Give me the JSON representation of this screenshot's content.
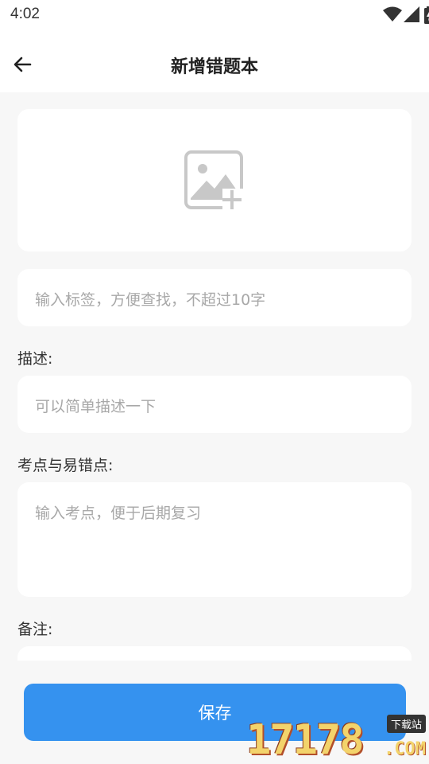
{
  "status_bar": {
    "time": "4:02",
    "icons": [
      "wifi-icon",
      "signal-icon",
      "battery-icon"
    ]
  },
  "app_bar": {
    "back_icon": "arrow-left-icon",
    "title": "新增错题本"
  },
  "form": {
    "image_upload_icon": "add-image-icon",
    "tag_placeholder": "输入标签，方便查找，不超过10字",
    "description_label": "描述:",
    "description_placeholder": "可以简单描述一下",
    "points_label": "考点与易错点:",
    "points_placeholder": "输入考点，便于后期复习",
    "note_label": "备注:"
  },
  "save_button": {
    "label": "保存"
  },
  "watermark": {
    "digits": "17178",
    "badge": "下载站",
    "suffix": ".COM"
  },
  "colors": {
    "accent": "#3592ef",
    "background": "#f7f7f7",
    "placeholder": "#a8a8a8"
  }
}
